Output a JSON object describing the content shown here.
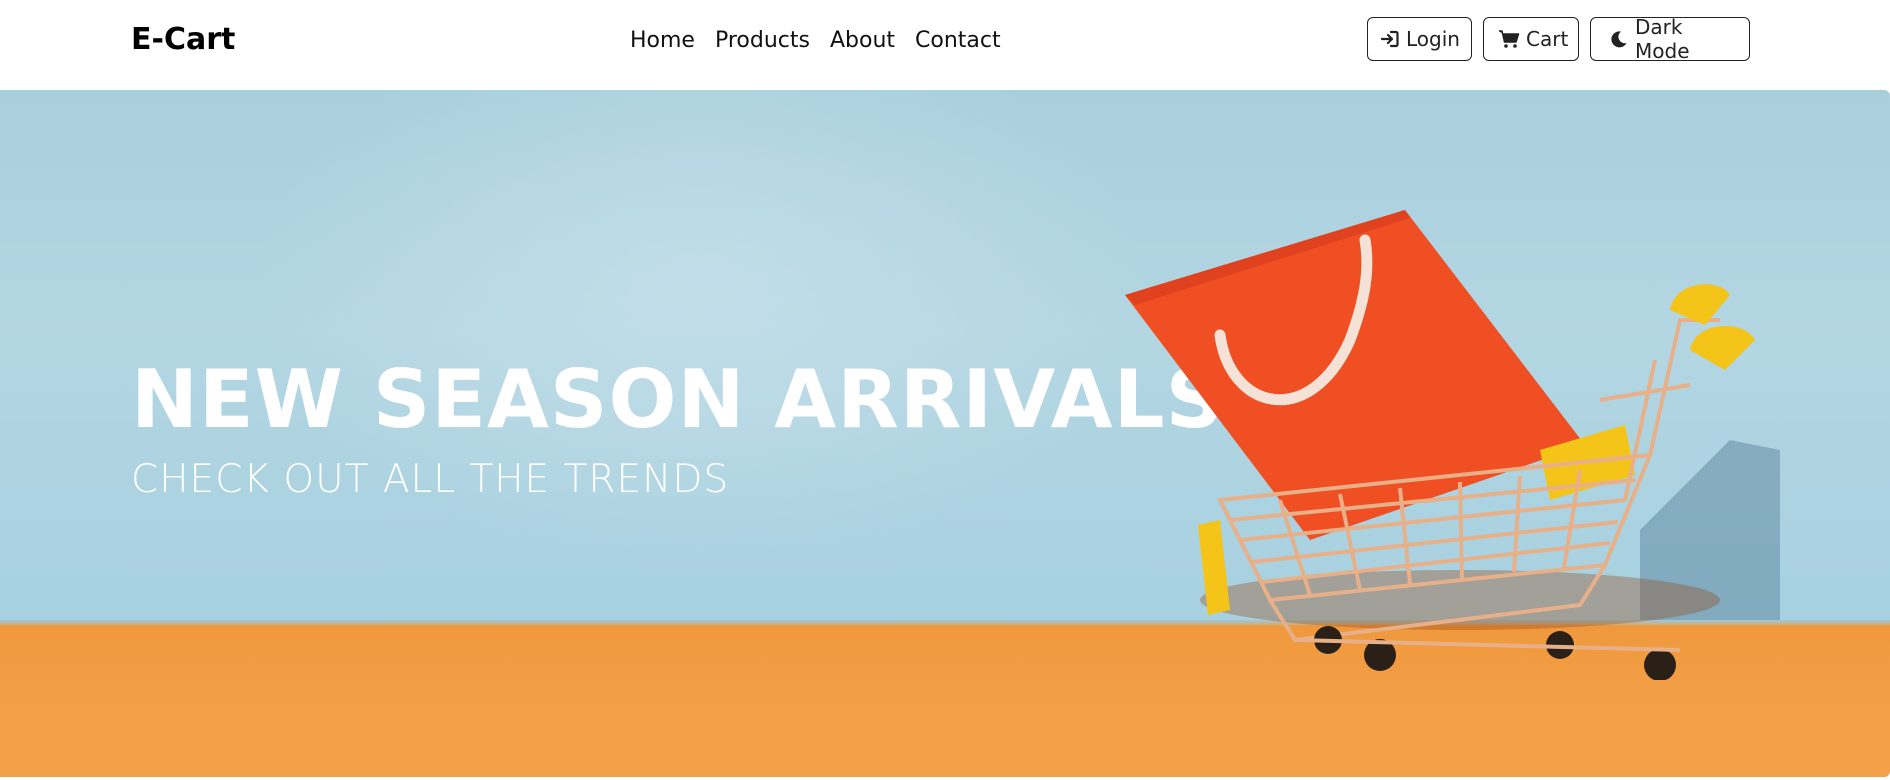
{
  "navbar": {
    "brand": "E-Cart",
    "links": [
      {
        "label": "Home"
      },
      {
        "label": "Products"
      },
      {
        "label": "About"
      },
      {
        "label": "Contact"
      }
    ],
    "buttons": {
      "login": {
        "label": "Login",
        "icon": "sign-in-icon"
      },
      "cart": {
        "label": "Cart",
        "icon": "cart-icon"
      },
      "dark_mode": {
        "label": "Dark Mode",
        "icon": "moon-icon"
      }
    }
  },
  "hero": {
    "title": "NEW SEASON ARRIVALS",
    "subtitle": "CHECK OUT ALL THE TRENDS",
    "image": "shopping-cart-with-red-bag-illustration"
  },
  "colors": {
    "sky": "#a9cfdd",
    "floor": "#f29e46",
    "bag": "#f04e23",
    "cart_handle": "#f5c419"
  }
}
